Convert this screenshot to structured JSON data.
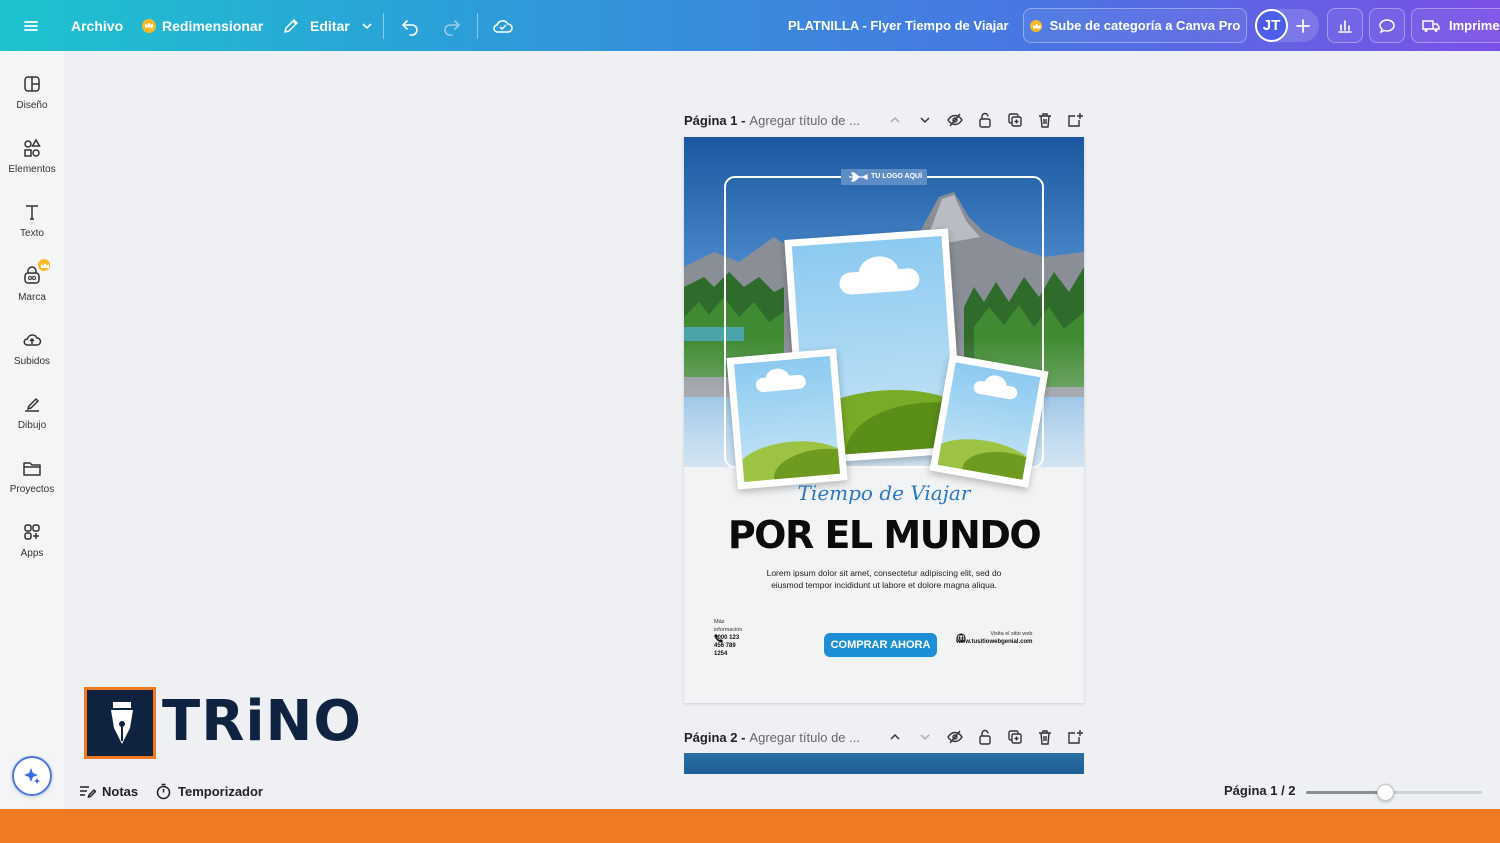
{
  "topbar": {
    "file_label": "Archivo",
    "resize_label": "Redimensionar",
    "edit_label": "Editar",
    "doc_title": "PLATNILLA - Flyer Tiempo de Viajar",
    "upgrade_label": "Sube de categoría a Canva Pro",
    "avatar_initials": "JT",
    "print_label": "Imprime"
  },
  "sidebar": {
    "items": [
      {
        "label": "Diseño",
        "icon": "layout-icon"
      },
      {
        "label": "Elementos",
        "icon": "elements-icon"
      },
      {
        "label": "Texto",
        "icon": "text-icon"
      },
      {
        "label": "Marca",
        "icon": "brand-icon"
      },
      {
        "label": "Subidos",
        "icon": "upload-icon"
      },
      {
        "label": "Dibujo",
        "icon": "draw-icon"
      },
      {
        "label": "Proyectos",
        "icon": "folder-icon"
      },
      {
        "label": "Apps",
        "icon": "apps-icon"
      }
    ]
  },
  "pages": [
    {
      "title": "Página 1 -",
      "subtitle": "Agregar título de ..."
    },
    {
      "title": "Página 2 -",
      "subtitle": "Agregar título de ..."
    }
  ],
  "flyer": {
    "logo_text": "TU LOGO AQUÍ",
    "script_title": "Tiempo de Viajar",
    "main_title": "POR EL MUNDO",
    "body": "Lorem ipsum dolor sit amet, consectetur adipiscing elit, sed do eiusmod tempor incididunt ut labore et dolore magna aliqua.",
    "info_label": "Más información",
    "phone": "+000 123 456 789 1254",
    "cta": "COMPRAR AHORA",
    "web_label": "Visita el sitio web",
    "web_url": "www.tusitiowebgenial.com"
  },
  "bottombar": {
    "notes_label": "Notas",
    "timer_label": "Temporizador",
    "page_indicator": "Página 1 / 2",
    "zoom_fraction": 0.45
  },
  "watermark": {
    "text": "TRiNO"
  },
  "colors": {
    "accent_orange": "#f07a22",
    "brand_navy": "#0f2340",
    "cta_blue": "#1d8fd6"
  }
}
